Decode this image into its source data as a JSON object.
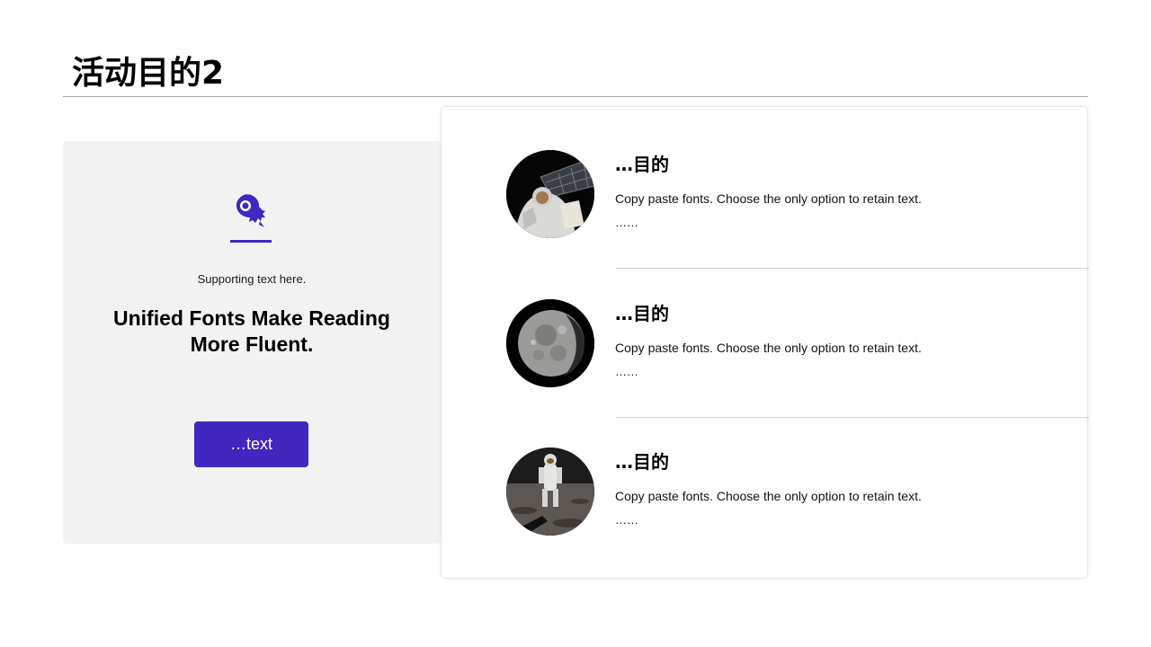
{
  "page": {
    "title": "活动目的2"
  },
  "left_panel": {
    "icon": "rocket-icon",
    "supporting_text": "Supporting  text here.",
    "headline": "Unified Fonts Make Reading More Fluent.",
    "button_label": "…text"
  },
  "items": [
    {
      "title": "…目的",
      "description": "Copy paste fonts. Choose the only option to retain text.",
      "more": "……",
      "image": "astronaut-spacewalk-image"
    },
    {
      "title": "…目的",
      "description": "Copy paste fonts. Choose the only option to retain text.",
      "more": "……",
      "image": "moon-image"
    },
    {
      "title": "…目的",
      "description": "Copy paste fonts. Choose the only option to retain text.",
      "more": "……",
      "image": "astronaut-on-moon-image"
    }
  ],
  "colors": {
    "accent": "#4226c0",
    "panel_background": "#f2f2f2",
    "rule": "#a6a6a6"
  }
}
